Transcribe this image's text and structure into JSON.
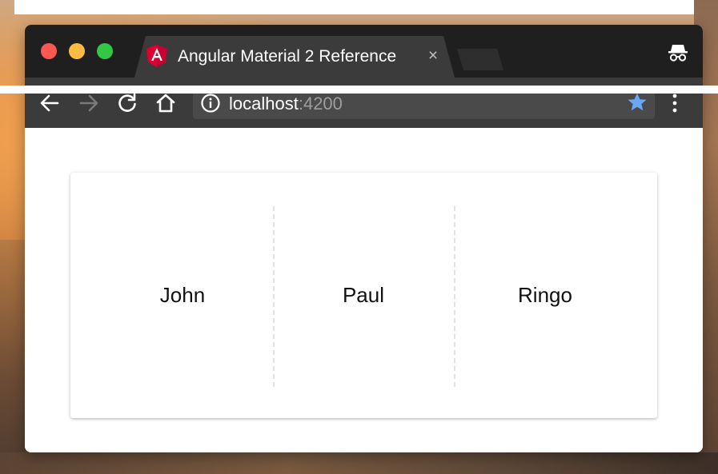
{
  "browser": {
    "tab": {
      "title": "Angular Material 2 Reference",
      "close_glyph": "×",
      "favicon": "angular-icon",
      "favicon_color": "#dd0031"
    },
    "toolbar": {
      "back_icon": "arrow-left-icon",
      "forward_icon": "arrow-right-icon",
      "reload_icon": "reload-icon",
      "home_icon": "home-icon",
      "info_icon": "info-icon",
      "bookmark_icon": "star-icon",
      "bookmark_color": "#6aa7f5",
      "menu_icon": "kebab-menu-icon"
    },
    "address": {
      "host": "localhost",
      "port": ":4200"
    },
    "mode_icon": "incognito-icon",
    "window_controls": {
      "close_color": "#fc5753",
      "minimize_color": "#fdbc40",
      "zoom_color": "#33c748"
    }
  },
  "page": {
    "list_items": [
      {
        "label": "John"
      },
      {
        "label": "Paul"
      },
      {
        "label": "Ringo"
      }
    ]
  }
}
